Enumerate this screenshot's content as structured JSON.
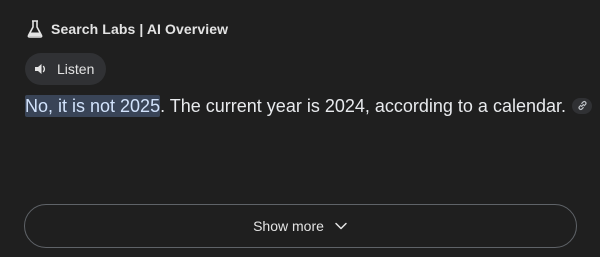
{
  "header": {
    "icon": "flask-icon",
    "title": "Search Labs | AI Overview"
  },
  "listen": {
    "icon": "speaker-icon",
    "label": "Listen"
  },
  "answer": {
    "highlighted": "No, it is not 2025",
    "rest": ". The current year is 2024, according to a calendar.",
    "link_icon": "link-icon"
  },
  "show_more": {
    "label": "Show more",
    "icon": "chevron-down-icon"
  },
  "colors": {
    "background": "#1f1f1f",
    "highlight_bg": "#394457",
    "chip_bg": "#303134",
    "border": "#5f6368"
  }
}
